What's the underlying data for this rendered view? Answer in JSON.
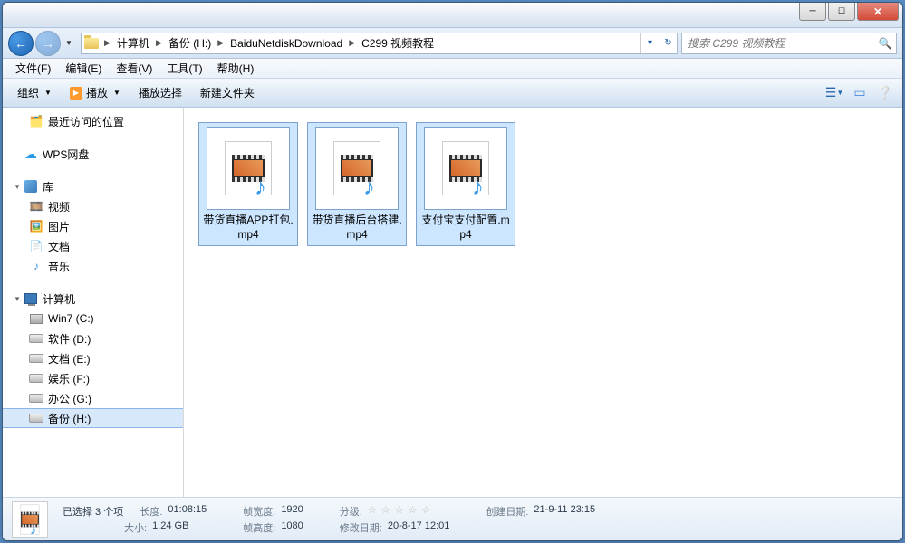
{
  "breadcrumb": [
    "计算机",
    "备份 (H:)",
    "BaiduNetdiskDownload",
    "C299 视频教程"
  ],
  "search_placeholder": "搜索 C299 视频教程",
  "menubar": [
    "文件(F)",
    "编辑(E)",
    "查看(V)",
    "工具(T)",
    "帮助(H)"
  ],
  "toolbar": {
    "organize": "组织",
    "play": "播放",
    "play_select": "播放选择",
    "new_folder": "新建文件夹"
  },
  "sidebar": {
    "recent": "最近访问的位置",
    "wps": "WPS网盘",
    "lib": "库",
    "lib_items": [
      "视频",
      "图片",
      "文档",
      "音乐"
    ],
    "computer": "计算机",
    "drives": [
      "Win7 (C:)",
      "软件 (D:)",
      "文档 (E:)",
      "娱乐 (F:)",
      "办公 (G:)",
      "备份 (H:)"
    ]
  },
  "files": [
    "带货直播APP打包.mp4",
    "带货直播后台搭建.mp4",
    "支付宝支付配置.mp4"
  ],
  "status": {
    "selected": "已选择 3 个项",
    "length_l": "长度:",
    "length_v": "01:08:15",
    "size_l": "大小:",
    "size_v": "1.24 GB",
    "fw_l": "帧宽度:",
    "fw_v": "1920",
    "fh_l": "帧高度:",
    "fh_v": "1080",
    "rating_l": "分级:",
    "mdate_l": "修改日期:",
    "mdate_v": "20-8-17 12:01",
    "cdate_l": "创建日期:",
    "cdate_v": "21-9-11 23:15"
  }
}
